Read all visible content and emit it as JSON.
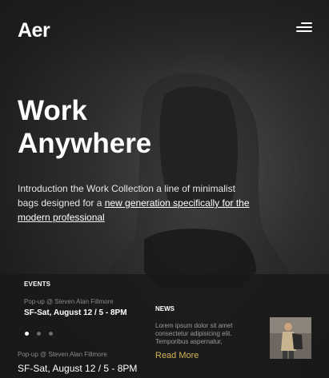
{
  "brand": {
    "logo_text": "Aer"
  },
  "header": {
    "menu_icon": "menu-icon"
  },
  "hero": {
    "headline_line1": "Work",
    "headline_line2": "Anywhere",
    "intro_text": "Introduction the Work Collection a line of minimalist bags designed for a ",
    "intro_link": "new generation specifically for the modern professional"
  },
  "events": {
    "title": "EVENTS",
    "items": [
      {
        "subtitle": "Pop-up @ Steven Alan Fillmore",
        "date": "SF-Sat, August 12 / 5 - 8PM"
      },
      {
        "subtitle": "Pop-up @ Steven Alan Fillmore",
        "date": "SF-Sat, August 12 / 5 - 8PM"
      }
    ],
    "carousel": {
      "count": 3,
      "active_index": 0
    }
  },
  "news": {
    "title": "NEWS",
    "body": "Lorem ipsum dolor sit amet consectetur adipisicing elit. Temporibus aspernatur,",
    "read_more": "Read More"
  },
  "colors": {
    "accent": "#d4b45a",
    "panel": "#181818",
    "background": "#1b1b1b"
  }
}
